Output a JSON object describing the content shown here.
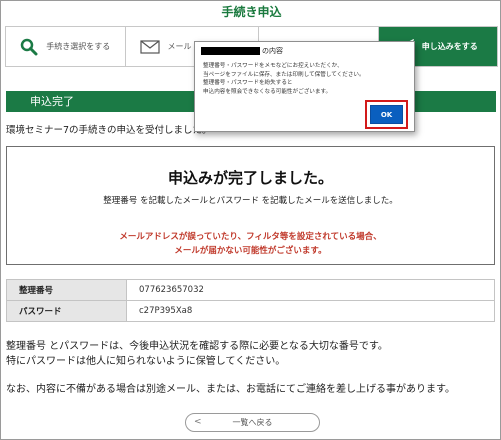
{
  "header": {
    "title": "手続き申込"
  },
  "steps": [
    {
      "label": "手続き選択をする",
      "icon": "search-icon"
    },
    {
      "label": "メール",
      "icon": "mail-icon"
    },
    {
      "label": "",
      "icon": ""
    },
    {
      "label": "申し込みをする",
      "icon": "send-icon"
    }
  ],
  "section": {
    "title": "申込完了"
  },
  "received_text": "環境セミナー7の手続きの申込を受付しました。",
  "done": {
    "title": "申込みが完了しました。",
    "subtitle": "整理番号 を記載したメールとパスワード を記載したメールを送信しました。",
    "warning_line1": "メールアドレスが誤っていたり、フィルタ等を設定されている場合、",
    "warning_line2": "メールが届かない可能性がございます。"
  },
  "info": [
    {
      "label": "整理番号",
      "value": "077623657032"
    },
    {
      "label": "パスワード",
      "value": "c27P395Xa8"
    }
  ],
  "notes": {
    "line1": "整理番号 とパスワードは、今後申込状況を確認する際に必要となる大切な番号です。",
    "line2": "特にパスワードは他人に知られないように保管してください。",
    "line3": "なお、内容に不備がある場合は別途メール、または、お電話にてご連絡を差し上げる事があります。"
  },
  "back_button": {
    "label": "一覧へ戻る"
  },
  "dialog": {
    "title_suffix": "の内容",
    "message_line1": "整理番号・パスワードをメモなどにお控えいただくか、",
    "message_line2": "当ページをファイルに保存、または印刷して保管してください。",
    "message_line3": "整理番号・パスワードを紛失すると",
    "message_line4": "申込内容を照会できなくなる可能性がございます。",
    "ok_label": "OK"
  },
  "colors": {
    "brand_green": "#1b7a45",
    "ok_blue": "#0a5fbf",
    "highlight_red": "#d21a1a",
    "warning_red": "#c0392b"
  }
}
